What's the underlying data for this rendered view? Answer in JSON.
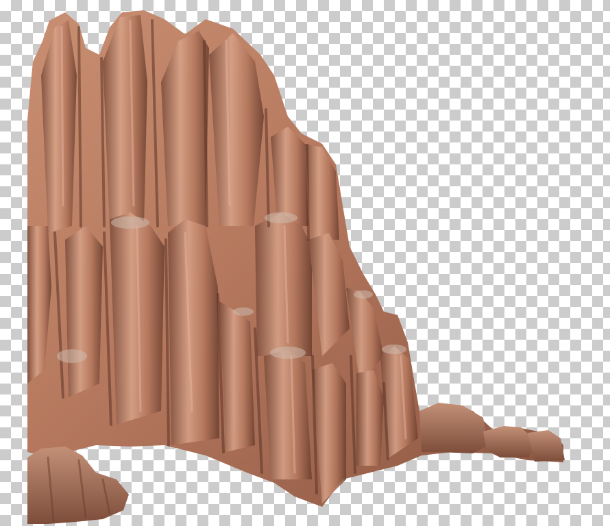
{
  "image": {
    "subject": "rock-formation",
    "background": "transparency-checkerboard",
    "colors": {
      "checker_light": "#ffffff",
      "checker_dark": "#cccccc",
      "rock_light": "#d9a48a",
      "rock_mid": "#b5785e",
      "rock_dark": "#7a4a38",
      "rock_shadow": "#5c3426",
      "rock_dust": "#cdb9ad"
    }
  }
}
